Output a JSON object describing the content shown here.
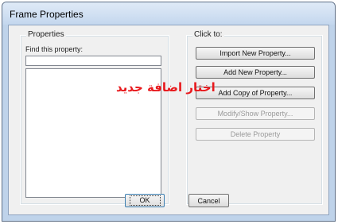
{
  "window": {
    "title": "Frame Properties"
  },
  "properties_group": {
    "legend": "Properties",
    "find_label": "Find this property:",
    "find_value": ""
  },
  "click_group": {
    "legend": "Click to:",
    "buttons": [
      {
        "label": "Import New Property...",
        "enabled": true
      },
      {
        "label": "Add New Property...",
        "enabled": true
      },
      {
        "label": "Add Copy of Property...",
        "enabled": true
      },
      {
        "label": "Modify/Show Property...",
        "enabled": false
      },
      {
        "label": "Delete Property",
        "enabled": false
      }
    ]
  },
  "footer": {
    "ok_label": "OK",
    "cancel_label": "Cancel"
  },
  "annotation": {
    "text": "اختار اضافة جديد",
    "color": "#e8191d"
  }
}
